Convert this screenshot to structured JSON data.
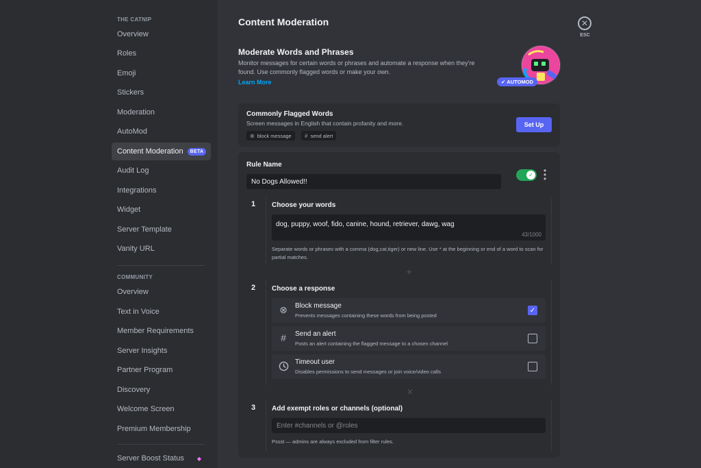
{
  "sidebar": {
    "server_header": "THE CATNIP",
    "server_items": [
      {
        "label": "Overview"
      },
      {
        "label": "Roles"
      },
      {
        "label": "Emoji"
      },
      {
        "label": "Stickers"
      },
      {
        "label": "Moderation"
      },
      {
        "label": "AutoMod"
      },
      {
        "label": "Content Moderation",
        "badge": "BETA",
        "active": true
      },
      {
        "label": "Audit Log"
      },
      {
        "label": "Integrations"
      },
      {
        "label": "Widget"
      },
      {
        "label": "Server Template"
      },
      {
        "label": "Vanity URL"
      }
    ],
    "community_header": "COMMUNITY",
    "community_items": [
      {
        "label": "Overview"
      },
      {
        "label": "Text in Voice"
      },
      {
        "label": "Member Requirements"
      },
      {
        "label": "Server Insights"
      },
      {
        "label": "Partner Program"
      },
      {
        "label": "Discovery"
      },
      {
        "label": "Welcome Screen"
      },
      {
        "label": "Premium Membership"
      }
    ],
    "boost_label": "Server Boost Status"
  },
  "page": {
    "title": "Content Moderation",
    "close_label": "ESC"
  },
  "intro": {
    "title": "Moderate Words and Phrases",
    "description": "Monitor messages for certain words or phrases and automate a response when they're found. Use commonly flagged words or make your own.",
    "learn_more": "Learn More",
    "badge": "AUTOMOD"
  },
  "flagged": {
    "title": "Commonly Flagged Words",
    "description": "Screen messages in English that contain profanity and more.",
    "chips": [
      {
        "icon": "block-icon",
        "label": "block message"
      },
      {
        "icon": "hash-icon",
        "label": "send alert"
      }
    ],
    "setup_label": "Set Up"
  },
  "rule": {
    "name_label": "Rule Name",
    "name_value": "No Dogs Allowed!!",
    "enabled": true,
    "steps": [
      {
        "number": "1",
        "title": "Choose your words",
        "words": "dog, puppy, woof, fido, canine, hound, retriever, dawg, wag",
        "count": "43/1000",
        "help": "Separate words or phrases with a comma (dog,cat,tiger) or new line. Use * at the beginning or end of a word to scan for partial matches."
      },
      {
        "number": "2",
        "title": "Choose a response",
        "responses": [
          {
            "icon": "block-icon",
            "title": "Block message",
            "description": "Prevents messages containing these words from being posted",
            "checked": true
          },
          {
            "icon": "hash-icon",
            "title": "Send an alert",
            "description": "Posts an alert containing the flagged message to a chosen channel",
            "checked": false
          },
          {
            "icon": "clock-icon",
            "title": "Timeout user",
            "description": "Disables permissions to send messages or join voice/video calls",
            "checked": false
          }
        ]
      },
      {
        "number": "3",
        "title": "Add exempt roles or channels (optional)",
        "placeholder": "Enter #channels or @roles",
        "help": "Pssst — admins are always excluded from filter rules."
      }
    ]
  },
  "colors": {
    "accent": "#5865f2",
    "toggle_on": "#23a559",
    "link": "#00a8fc",
    "boost": "#ff73fa"
  }
}
